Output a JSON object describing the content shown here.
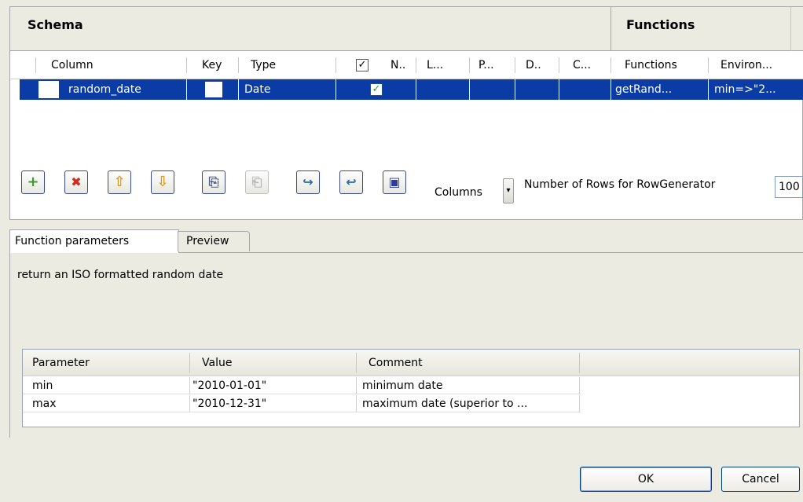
{
  "schema": {
    "title": "Schema",
    "functions_title": "Functions",
    "columns": [
      "Column",
      "Key",
      "Type",
      "N..",
      "L...",
      "P...",
      "D..",
      "C...",
      "Functions",
      "Environ..."
    ],
    "header_checkbox": "✓",
    "row": {
      "column": "random_date",
      "type": "Date",
      "nullable_check": "✓",
      "function": "getRand...",
      "environment": "min=>\"2..."
    }
  },
  "toolbar": {
    "add_icon": "+",
    "remove_icon": "✖",
    "up_icon": "⇧",
    "down_icon": "⇩",
    "copy_icon": "⎘",
    "paste_icon": "⎗",
    "import_icon": "↪",
    "export_icon": "↩",
    "save_icon": "▣",
    "columns_label": "Columns",
    "columns_dropdown_icon": "▾",
    "rows_label": "Number of Rows for RowGenerator",
    "rows_value": "100"
  },
  "tabs": {
    "function_parameters": "Function parameters",
    "preview": "Preview"
  },
  "function_description": "return an ISO formatted random date",
  "param_table": {
    "headers": [
      "Parameter",
      "Value",
      "Comment"
    ],
    "rows": [
      {
        "parameter": "min",
        "value": "\"2010-01-01\"",
        "comment": "minimum date"
      },
      {
        "parameter": "max",
        "value": "\"2010-12-31\"",
        "comment": "maximum date (superior to ..."
      }
    ]
  },
  "buttons": {
    "ok": "OK",
    "cancel": "Cancel"
  },
  "colors": {
    "selection": "#0b3ca6",
    "background": "#ecebe1",
    "add_green": "#3c9a2b",
    "remove_red": "#d42a1a",
    "arrow_orange": "#e59a1d",
    "save_blue": "#2a3d9a"
  }
}
